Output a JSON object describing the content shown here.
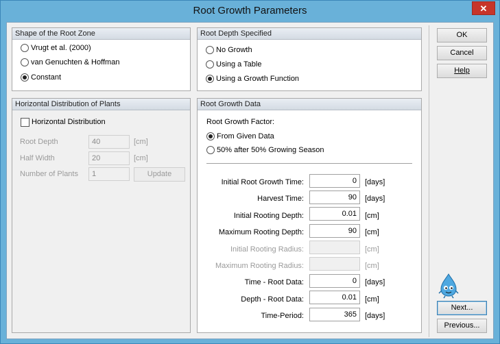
{
  "window": {
    "title": "Root Growth Parameters",
    "close_glyph": "✕"
  },
  "shape": {
    "title": "Shape of the Root Zone",
    "options": [
      {
        "label": "Vrugt et al. (2000)",
        "checked": false
      },
      {
        "label": "van Genuchten & Hoffman",
        "checked": false
      },
      {
        "label": "Constant",
        "checked": true
      }
    ]
  },
  "depth_spec": {
    "title": "Root Depth Specified",
    "options": [
      {
        "label": "No Growth",
        "checked": false
      },
      {
        "label": "Using a Table",
        "checked": false
      },
      {
        "label": "Using a Growth Function",
        "checked": true
      }
    ]
  },
  "horizontal": {
    "title": "Horizontal Distribution of Plants",
    "checkbox_label": "Horizontal Distribution",
    "checked": false,
    "fields": [
      {
        "label": "Root Depth",
        "value": "40",
        "unit": "[cm]"
      },
      {
        "label": "Half Width",
        "value": "20",
        "unit": "[cm]"
      },
      {
        "label": "Number of Plants",
        "value": "1",
        "unit": ""
      }
    ],
    "update_label": "Update"
  },
  "growth": {
    "title": "Root Growth Data",
    "factor_label": "Root Growth Factor:",
    "factor_options": [
      {
        "label": "From Given Data",
        "checked": true
      },
      {
        "label": "50% after 50% Growing Season",
        "checked": false
      }
    ],
    "rows": [
      {
        "label": "Initial Root Growth Time:",
        "value": "0",
        "unit": "[days]",
        "enabled": true
      },
      {
        "label": "Harvest Time:",
        "value": "90",
        "unit": "[days]",
        "enabled": true
      },
      {
        "label": "Initial Rooting Depth:",
        "value": "0.01",
        "unit": "[cm]",
        "enabled": true
      },
      {
        "label": "Maximum Rooting Depth:",
        "value": "90",
        "unit": "[cm]",
        "enabled": true
      },
      {
        "label": "Initial Rooting Radius:",
        "value": "",
        "unit": "[cm]",
        "enabled": false
      },
      {
        "label": "Maximum Rooting Radius:",
        "value": "",
        "unit": "[cm]",
        "enabled": false
      },
      {
        "label": "Time - Root Data:",
        "value": "0",
        "unit": "[days]",
        "enabled": true
      },
      {
        "label": "Depth - Root Data:",
        "value": "0.01",
        "unit": "[cm]",
        "enabled": true
      },
      {
        "label": "Time-Period:",
        "value": "365",
        "unit": "[days]",
        "enabled": true
      }
    ]
  },
  "buttons": {
    "ok": "OK",
    "cancel": "Cancel",
    "help": "Help",
    "next": "Next...",
    "previous": "Previous..."
  },
  "mascot_icon": "water-drop-mascot-icon"
}
